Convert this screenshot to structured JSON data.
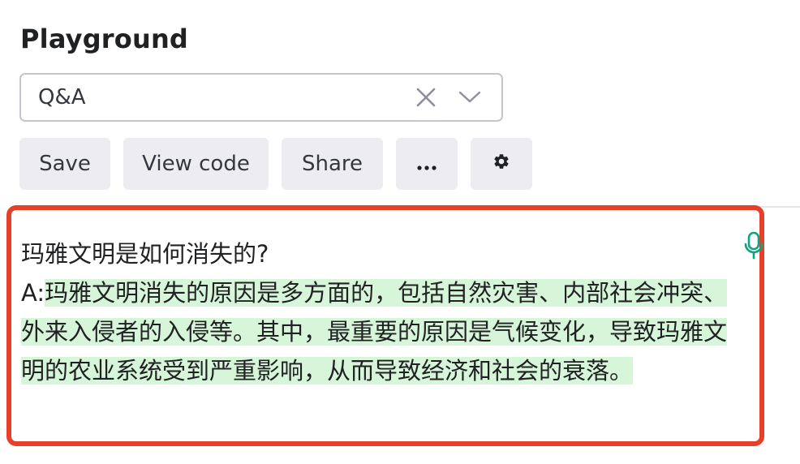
{
  "header": {
    "title": "Playground"
  },
  "preset": {
    "value": "Q&A"
  },
  "toolbar": {
    "save_label": "Save",
    "view_code_label": "View code",
    "share_label": "Share",
    "more_label": "···"
  },
  "editor": {
    "prompt_text": "玛雅文明是如何消失的?",
    "answer_prefix": "A:",
    "completion_text": "玛雅文明消失的原因是多方面的，包括自然灾害、内部社会冲突、外来入侵者的入侵等。其中，最重要的原因是气候变化，导致玛雅文明的农业系统受到严重影响，从而导致经济和社会的衰落。"
  },
  "colors": {
    "highlight_border": "#e6402b",
    "completion_highlight": "#d7f5d9",
    "button_bg": "#ececf1",
    "mic_icon": "#10a37f"
  },
  "icons": [
    "clear-icon",
    "chevron-down-icon",
    "more-icon",
    "gear-icon",
    "microphone-icon"
  ]
}
